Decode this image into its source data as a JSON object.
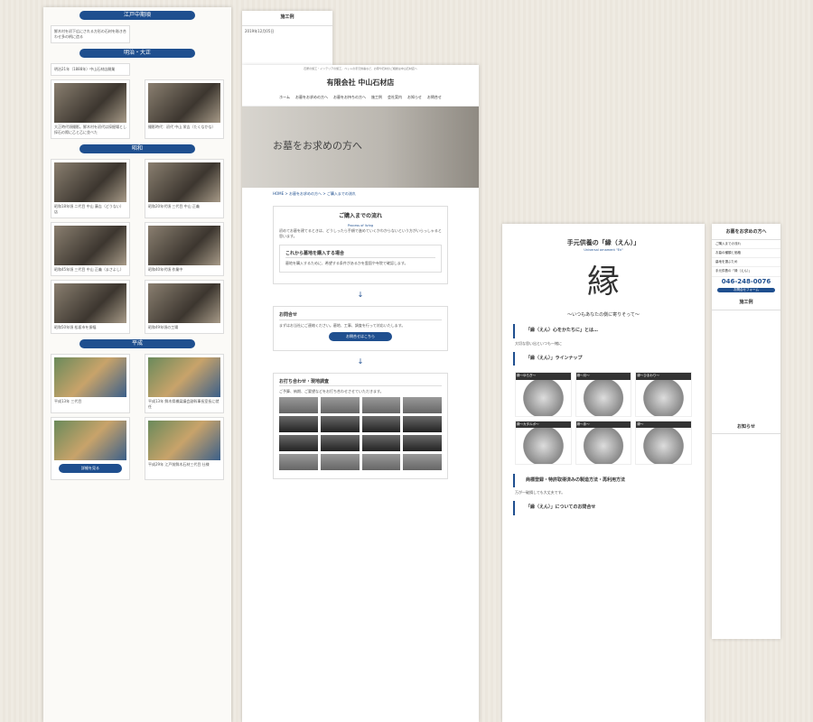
{
  "timeline": {
    "era_edo": "江戸中期頃",
    "intro": "鮮木村を初下広にされる方形の石材を彫き合わせ多の柄に造る",
    "era_meiji": "明治・大正",
    "meiji_note": "明治21年（1888年）中山石材店開業",
    "caption1": "大正時代頃撮影。鮮木村を初代は採掘場とし採石の際に乙と乙に並べた",
    "caption2": "撮影時代：初代 中山 栄吉（たくなかな）",
    "era_showa": "昭和",
    "caption3": "昭和18年頃 二代目 中山 藤吉（どうない）店",
    "caption4": "昭和20年代頃 三代目 中山 正義",
    "caption5": "昭和40年代頃 作業中",
    "caption6": "昭和45年頃 三代目 中山 正義（まさよし）",
    "caption7": "昭和49年頃の工場",
    "caption8": "昭和50年頃 松坂市を振幅",
    "era_heisei": "平成",
    "caption9": "平成13年 三代目",
    "caption10": "平成13年 鮮木県橋梁議会副幹事長室長に就任",
    "caption11": "平成29年 江戸前鮮木石材三代目 仕様",
    "btn": "詳細を見る"
  },
  "news": {
    "title": "施工例",
    "date": "2019年12月05日"
  },
  "main": {
    "topbar": "石屋の施工・インテリアの施工、ペットの手元供養など、お墓や石材のご相談は中山石材店へ",
    "logo": "有限会社 中山石材店",
    "nav": [
      "ホーム",
      "お墓をお求めの方へ",
      "お墓をお持ちの方へ",
      "施工例",
      "会社案内",
      "お知らせ",
      "お問合せ"
    ],
    "hero": "お墓をお求めの方へ",
    "crumb": "HOME > お墓をお求めの方へ > ご購入までの流れ",
    "flow_title": "ご購入までの流れ",
    "flow_en": "Process of living",
    "flow_text": "初めてお墓を建てるときは、どうしったら手順で進めていくかわからないという方がいらっしゃると思います。",
    "plot_title": "これから墓地を購入する場合",
    "plot_text": "墓地を購入するために、希望する条件があるかを霊園や寺院で確認します。",
    "contact_title": "お問合せ",
    "contact_text": "まずはお当社にご連絡ください。墓地、工事、調査を行って対応いたします。",
    "contact_btn": "お問合せはこちら",
    "meet_title": "お打ち合わせ・現地調査",
    "meet_text": "ご予算、納期、ご要望などをお打ち合わせさせていただきます。"
  },
  "prod": {
    "title": "手元供養の「縁（えん）」",
    "en": "Universal ornament \"En\"",
    "kanji": "縁",
    "tagline": "〜いつもあなたの側に寄りそって〜",
    "sec1": "「縁（えん）心をかたちに」とは…",
    "text1": "大切な思い出といつも一緒に",
    "sec2": "「縁（えん）」ラインナップ",
    "items": [
      "縁〜ゆらぎ〜",
      "縁〜月〜",
      "縁〜ひまわり〜",
      "縁〜カタルボ〜",
      "縁〜あ〜",
      "縁〜"
    ],
    "sec3": "商標登録・特許取得済みの製造方法・再利用方法",
    "text3": "万が一破損しても大丈夫です。",
    "sec4": "「縁（えん）」についてのお問合せ"
  },
  "side": {
    "title1": "お墓をお求めの方へ",
    "items": [
      "ご購入までの流れ",
      "お墓の種類と価格",
      "墓地を選ぶため",
      "手元供養の「縁（えん）」"
    ],
    "tel": "046-248-0076",
    "form": "お問合せフォーム",
    "title2": "施工例",
    "title3": "お知らせ"
  }
}
